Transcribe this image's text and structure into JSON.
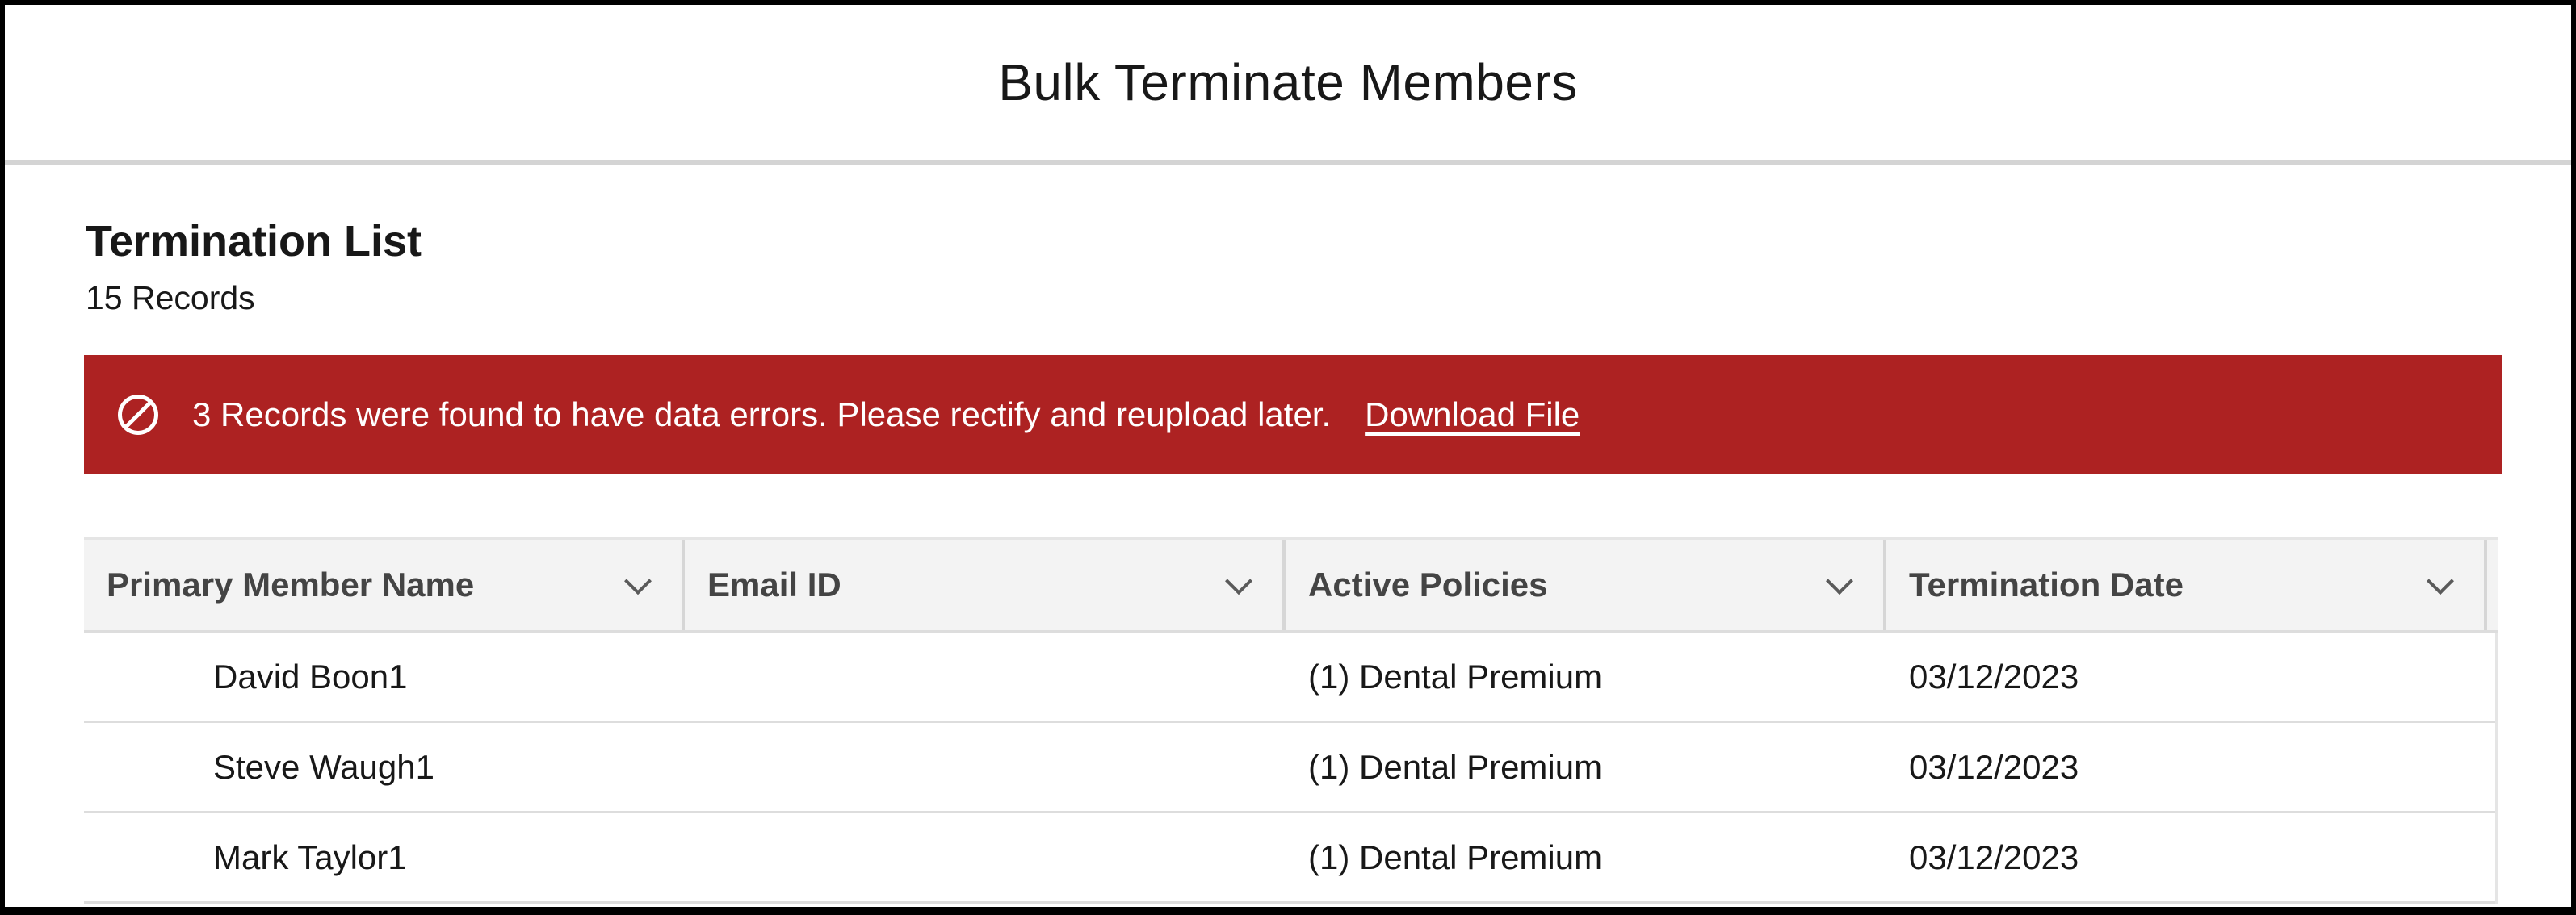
{
  "modal": {
    "title": "Bulk Terminate Members"
  },
  "section": {
    "title": "Termination List",
    "record_count": "15 Records"
  },
  "error_banner": {
    "icon": "ban-icon",
    "message": "3 Records were found to have data errors. Please rectify and reupload later.",
    "link_label": "Download File",
    "color": "#ad2222"
  },
  "table": {
    "columns": [
      {
        "label": "Primary Member Name"
      },
      {
        "label": "Email ID"
      },
      {
        "label": "Active Policies"
      },
      {
        "label": "Termination Date"
      }
    ],
    "rows": [
      {
        "name": "David Boon1",
        "email": "",
        "policies": "(1) Dental Premium",
        "date": "03/12/2023"
      },
      {
        "name": "Steve Waugh1",
        "email": "",
        "policies": "(1) Dental Premium",
        "date": "03/12/2023"
      },
      {
        "name": "Mark Taylor1",
        "email": "",
        "policies": "(1) Dental Premium",
        "date": "03/12/2023"
      }
    ]
  }
}
